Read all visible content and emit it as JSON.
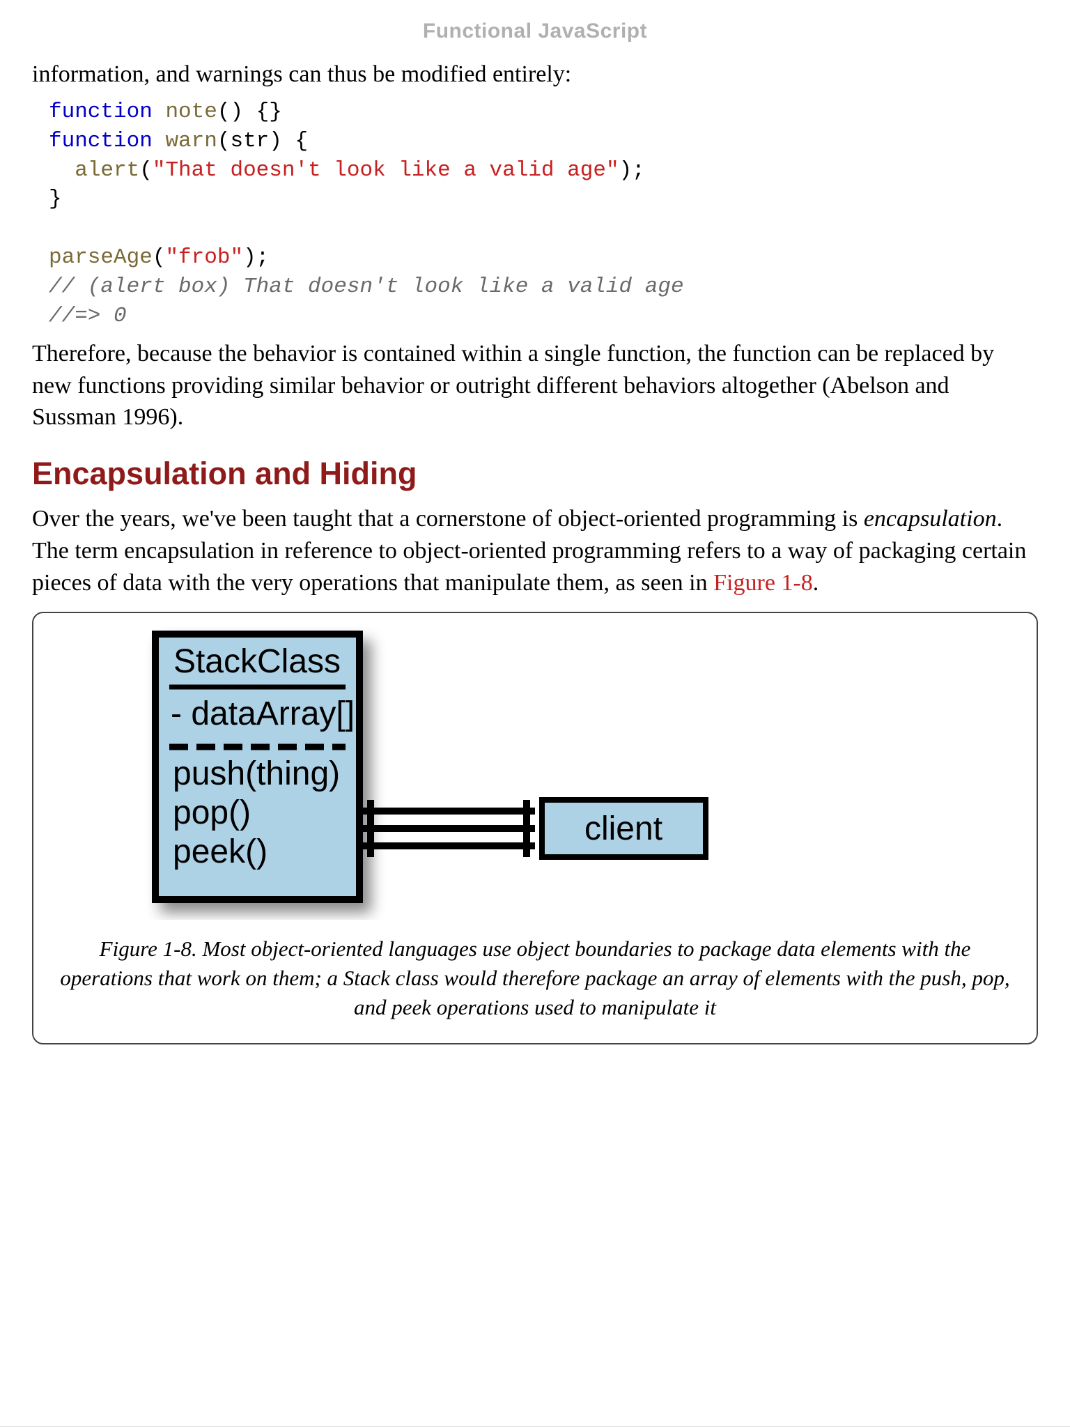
{
  "header": {
    "title": "Functional JavaScript"
  },
  "intro": "information, and warnings can thus be modified entirely:",
  "code": {
    "kw1": "function",
    "fnNote": "note",
    "noteParens": "() {}",
    "kw2": "function",
    "fnWarn": "warn",
    "warnParam": "(str) {",
    "alert": "alert",
    "alertOpen": "(",
    "alertStr": "\"That doesn't look like a valid age\"",
    "alertClose": ");",
    "closeBrace": "}",
    "parseAge": "parseAge",
    "parseOpen": "(",
    "parseStr": "\"frob\"",
    "parseClose": ");",
    "comment1": "// (alert box) That doesn't look like a valid age",
    "comment2": "//=> 0"
  },
  "para2": "Therefore, because the behavior is contained within a single function, the function can be replaced by new functions providing similar behavior or outright different behaviors altogether (Abelson and Sussman 1996).",
  "sectionHeading": "Encapsulation and Hiding",
  "para3a": "Over the years, we've been taught that a cornerstone of object-oriented programming is ",
  "para3em": "encapsulation",
  "para3b": ". The term encapsulation in reference to object-oriented programming refers to a way of packaging certain pieces of data with the very operations that manipulate them, as seen in ",
  "para3link": "Figure 1-8",
  "para3c": ".",
  "diagram": {
    "stackTitle": "StackClass",
    "stackData": "-  dataArray[]",
    "stackM1": "push(thing)",
    "stackM2": "pop()",
    "stackM3": "peek()",
    "client": "client"
  },
  "caption": "Figure 1-8. Most object-oriented languages use object boundaries to package data elements with the operations that work on them; a Stack class would therefore package an array of elements with the push, pop, and peek operations used to manipulate it"
}
